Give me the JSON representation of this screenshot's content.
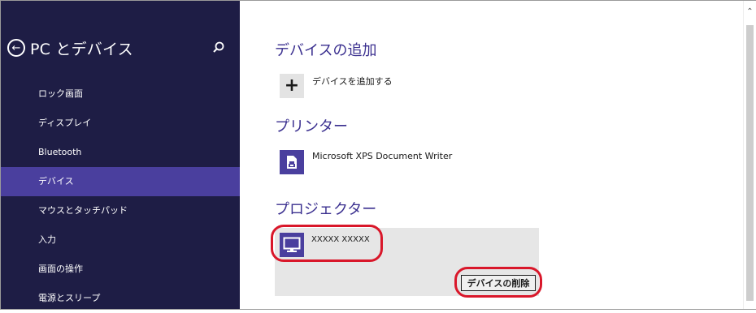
{
  "sidebar": {
    "title": "PC とデバイス",
    "items": [
      {
        "label": "ロック画面"
      },
      {
        "label": "ディスプレイ"
      },
      {
        "label": "Bluetooth"
      },
      {
        "label": "デバイス"
      },
      {
        "label": "マウスとタッチパッド"
      },
      {
        "label": "入力"
      },
      {
        "label": "画面の操作"
      },
      {
        "label": "電源とスリープ"
      }
    ],
    "active_item": "デバイス",
    "icons": {
      "back": "back-arrow-icon",
      "search": "search-icon"
    }
  },
  "main": {
    "add_section": {
      "heading": "デバイスの追加",
      "add_label": "デバイスを追加する"
    },
    "printer_section": {
      "heading": "プリンター",
      "printer_name": "Microsoft XPS Document Writer"
    },
    "projector_section": {
      "heading": "プロジェクター",
      "projector_name": "XXXXX XXXXX",
      "remove_button": "デバイスの削除"
    }
  },
  "colors": {
    "sidebar_bg": "#1e1d45",
    "active_item": "#4a3f9e",
    "accent": "#3a2f8f",
    "highlight_ring": "#d9172a"
  }
}
